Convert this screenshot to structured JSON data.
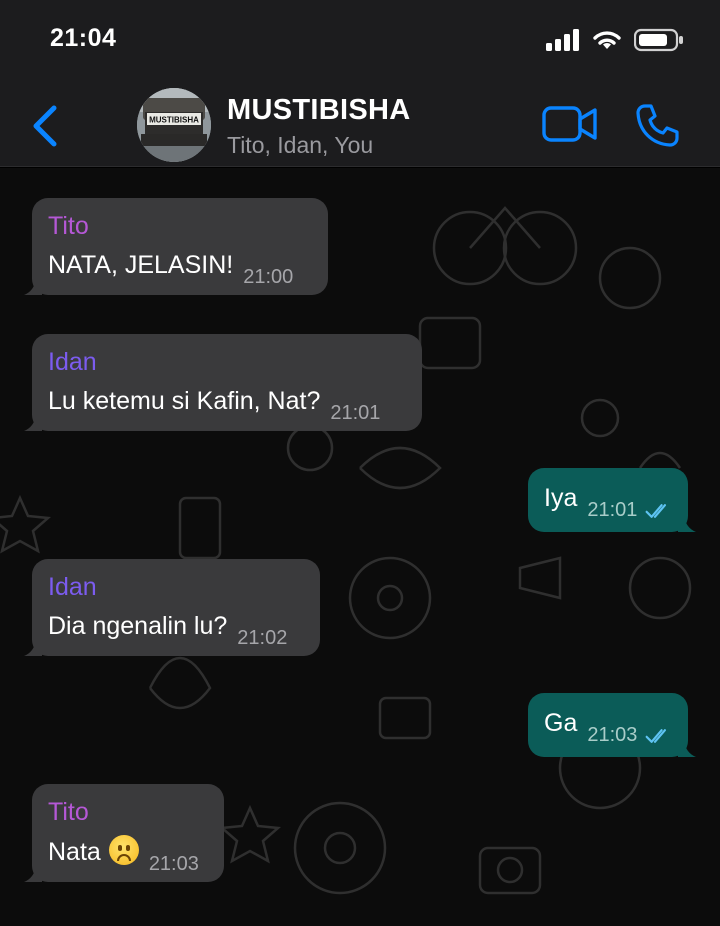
{
  "status_bar": {
    "time": "21:04"
  },
  "header": {
    "group_name": "MUSTIBISHA",
    "members": "Tito, Idan, You",
    "avatar_text": "MUSTIBISHA"
  },
  "colors": {
    "accent": "#0a84ff",
    "outgoing_bubble": "#0b5c58",
    "incoming_bubble": "#3a3a3c",
    "tito_name": "#b558d6",
    "idan_name": "#7c5cf0",
    "read_tick": "#5ec3f2"
  },
  "messages": [
    {
      "direction": "in",
      "sender": "Tito",
      "text": "NATA, JELASIN!",
      "time": "21:00"
    },
    {
      "direction": "in",
      "sender": "Idan",
      "text": "Lu ketemu si Kafin, Nat?",
      "time": "21:01"
    },
    {
      "direction": "out",
      "text": "Iya",
      "time": "21:01",
      "status": "read"
    },
    {
      "direction": "in",
      "sender": "Idan",
      "text": "Dia ngenalin lu?",
      "time": "21:02"
    },
    {
      "direction": "out",
      "text": "Ga",
      "time": "21:03",
      "status": "read"
    },
    {
      "direction": "in",
      "sender": "Tito",
      "text": "Nata",
      "emoji": "frowning-face-icon",
      "time": "21:03"
    }
  ]
}
